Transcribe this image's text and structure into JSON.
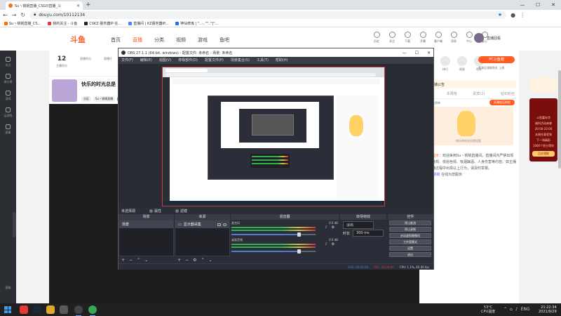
{
  "browser": {
    "tab_title": "Su丶锅锅直播_CSGO直播_斗",
    "url": "douyu.com/10112134",
    "bookmarks": [
      "Su丶锅锅直播_CS...",
      "我的关注 - 斗鱼",
      "CSKZ 服务器IP 在...",
      "直播间 | KZ服务器IP...",
      "神仙修炼 | \"..-..\"\"..\"|\"..."
    ]
  },
  "douyu": {
    "logo": "斗鱼",
    "nav": [
      "首页",
      "直播",
      "分类",
      "视频",
      "游戏",
      "鱼吧"
    ],
    "header_icons": [
      "历史",
      "关注",
      "下载",
      "开播",
      "客户端",
      "消息",
      "中心",
      "爱心"
    ],
    "username": "直播回看",
    "sidebar": [
      "关注",
      "排行榜",
      "游戏",
      "云游戏",
      "赛事"
    ],
    "sidebar_bottom": "客服",
    "stats": [
      {
        "value": "12",
        "label": "主播积分"
      },
      {
        "value": "",
        "label": "直播积分"
      },
      {
        "value": "",
        "label": "直播片"
      }
    ],
    "room_title": "快乐的时光总是",
    "room_meta": [
      "分区",
      "Su丶锅锅直播",
      "V等级",
      "粉丝团"
    ],
    "pc_button": "PC斗鱼端",
    "login_hint": "登录后领取鱼丸 上线",
    "right_stats": [
      "贡献",
      "排行",
      "周星",
      "鱼丸"
    ],
    "notice": "主播公告",
    "right_tabs": [
      "贵宾",
      "本周榜",
      "贵宾(2)",
      "钻石粉丝"
    ],
    "fans_text": "钻石粉丝榜单",
    "fans_button": "开通钻石粉丝",
    "art_caption": "快乐的时光总是短暂",
    "chat_system": "系统提示：",
    "chat_body": "欢迎来到Su丶锅锅直播间，直播间内严禁出现违法违规、低俗色情、吸烟酗酒、人身伤害等内容。如主播在直播过程中出现以上行为，请及时举报。",
    "chat_sender": "Su丶锅锅",
    "chat_tail": "在线为您服务",
    "ad_title": "斗鱼嘉年华",
    "ad_lines": [
      "福利活动来袭",
      "20:00-22:00",
      "本周任意签到",
      "下一场精彩",
      "1000个积分等你"
    ],
    "ad_cta": "点击领取"
  },
  "obs": {
    "title": "OBS 27.1.1 (64-bit, windows) - 配置文件: 未命名 - 场景: 未命名",
    "menu": [
      "文件(F)",
      "编辑(E)",
      "视图(V)",
      "停靠部件(D)",
      "配置文件(P)",
      "场景集合(S)",
      "工具(T)",
      "帮助(H)"
    ],
    "scene_bar": [
      "未选择源",
      "属性",
      "滤镜"
    ],
    "docks": [
      "场景",
      "来源",
      "混音器",
      "转场特效",
      "控件"
    ],
    "scene_item": "场景",
    "source_item": "显示器采集",
    "mixer": [
      {
        "name": "麦克风",
        "db": "0.0 dB",
        "level": 0.8
      },
      {
        "name": "桌面音频",
        "db": "0.0 dB",
        "level": 0.8
      }
    ],
    "transition": {
      "type": "淡出",
      "duration_label": "时长",
      "duration": "300 ms"
    },
    "controls": [
      "停止推流",
      "停止录制",
      "启动虚拟摄像机",
      "工作室模式",
      "设置",
      "退出"
    ],
    "status": {
      "live": "LIVE: 00:00:00",
      "rec": "REC: 00:00:00",
      "cpu": "CPU: 1.1%, 60.00 fps"
    }
  },
  "taskbar": {
    "temperature": "53°C",
    "temp_label": "CPU温度",
    "ime": "ENG",
    "time": "21:22:34",
    "date": "2021/9/29"
  },
  "colors": {
    "accent": "#ff5d23",
    "obs_bg": "#2b2e38",
    "taskbar": "#202020",
    "browser_bar": "#dee1e6"
  }
}
